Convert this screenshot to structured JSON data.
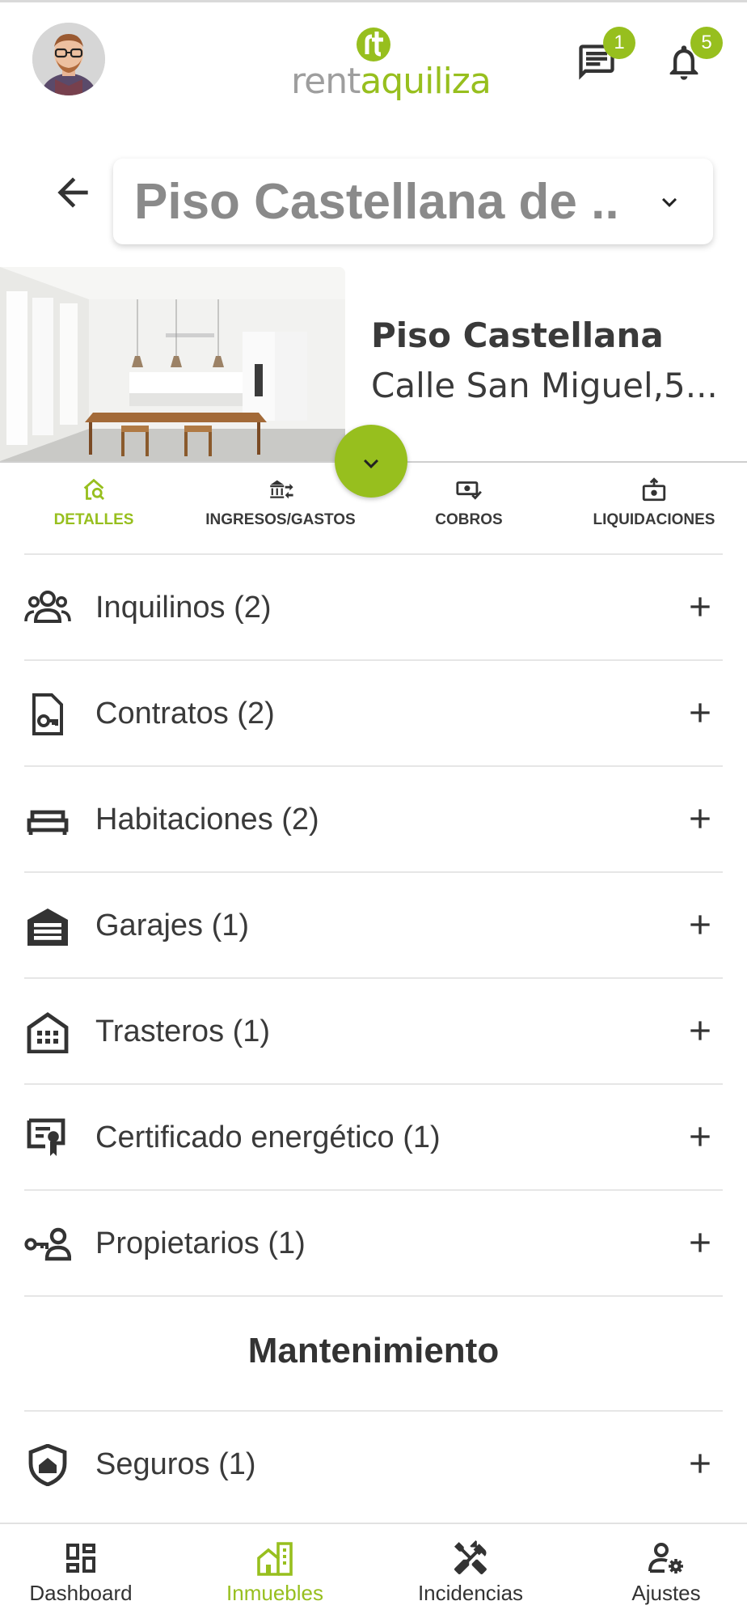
{
  "header": {
    "logo_text_1": "rent",
    "logo_text_2": "aquiliza",
    "messages_badge": "1",
    "notifications_badge": "5"
  },
  "selector": {
    "value": "Piso Castellana de ..."
  },
  "property": {
    "name": "Piso Castellana",
    "address": "Calle San Miguel,5..."
  },
  "tabs": [
    {
      "label": "DETALLES",
      "icon": "home-search-icon",
      "active": true
    },
    {
      "label": "INGRESOS/GASTOS",
      "icon": "bank-transfer-icon",
      "active": false
    },
    {
      "label": "COBROS",
      "icon": "cash-check-icon",
      "active": false
    },
    {
      "label": "LIQUIDACIONES",
      "icon": "cash-register-icon",
      "active": false
    }
  ],
  "items": [
    {
      "label": "Inquilinos (2)",
      "icon": "tenants-icon"
    },
    {
      "label": "Contratos (2)",
      "icon": "contract-key-icon"
    },
    {
      "label": "Habitaciones (2)",
      "icon": "bed-icon"
    },
    {
      "label": "Garajes (1)",
      "icon": "garage-icon"
    },
    {
      "label": "Trasteros (1)",
      "icon": "storage-building-icon"
    },
    {
      "label": "Certificado energético (1)",
      "icon": "certificate-icon"
    },
    {
      "label": "Propietarios (1)",
      "icon": "owner-key-icon"
    }
  ],
  "maintenance": {
    "title": "Mantenimiento",
    "items": [
      {
        "label": "Seguros (1)",
        "icon": "shield-home-icon"
      }
    ]
  },
  "bottom_nav": [
    {
      "label": "Dashboard",
      "icon": "dashboard-icon",
      "active": false
    },
    {
      "label": "Inmuebles",
      "icon": "building-icon",
      "active": true
    },
    {
      "label": "Incidencias",
      "icon": "tools-icon",
      "active": false
    },
    {
      "label": "Ajustes",
      "icon": "user-settings-icon",
      "active": false
    }
  ],
  "colors": {
    "accent": "#97bf1e",
    "text": "#3a3a3a",
    "muted": "#8a8a8a",
    "divider": "#e6e6e6"
  }
}
